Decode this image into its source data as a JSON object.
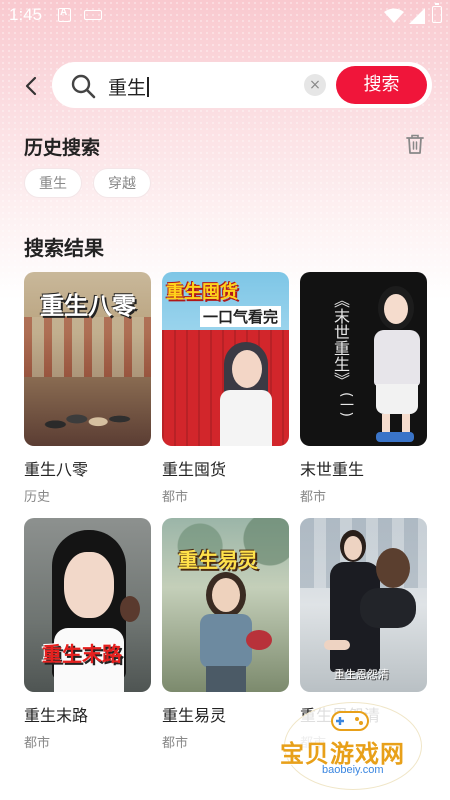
{
  "status_bar": {
    "time": "1:45"
  },
  "search": {
    "query": "重生",
    "button_label": "搜索",
    "clear_symbol": "×"
  },
  "history": {
    "title": "历史搜索",
    "items": [
      "重生",
      "穿越"
    ]
  },
  "results": {
    "title": "搜索结果",
    "items": [
      {
        "title": "重生八零",
        "tag": "历史",
        "cover_text": "重生八零"
      },
      {
        "title": "重生囤货",
        "tag": "都市",
        "cover_text": "重生囤货",
        "cover_subtext": "一口气看完"
      },
      {
        "title": "末世重生",
        "tag": "都市",
        "cover_text": "《末世重生》",
        "cover_subtext": "(一)"
      },
      {
        "title": "重生末路",
        "tag": "都市",
        "cover_text": "重生末路"
      },
      {
        "title": "重生易灵",
        "tag": "都市",
        "cover_text": "重生易灵"
      },
      {
        "title": "重生恩怨清",
        "tag": "都市",
        "cover_text": "重生恩怨清"
      }
    ]
  },
  "watermark": {
    "text": "宝贝游戏网",
    "url": "baobeiy.com"
  },
  "colors": {
    "accent": "#f0153a",
    "header_gradient": "#f9c9cf"
  }
}
